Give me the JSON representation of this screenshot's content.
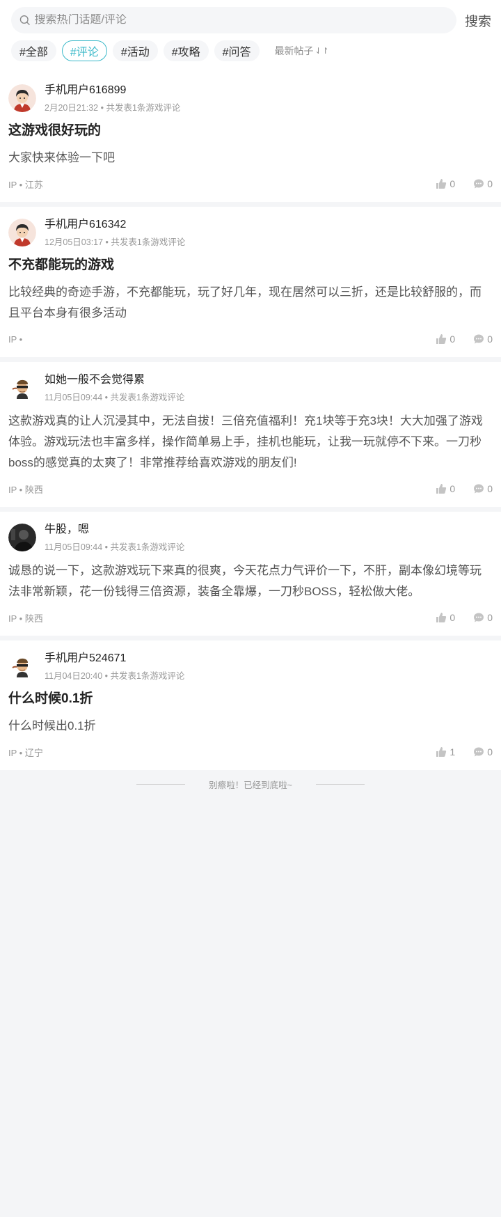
{
  "search": {
    "placeholder": "搜索热门话题/评论",
    "button": "搜索"
  },
  "tabs": [
    {
      "label": "#全部"
    },
    {
      "label": "#评论"
    },
    {
      "label": "#活动"
    },
    {
      "label": "#攻略"
    },
    {
      "label": "#问答"
    }
  ],
  "active_tab": "#评论",
  "sort_label": "最新帖子",
  "accent_color": "#3bb9c9",
  "posts": [
    {
      "user": "手机用户616899",
      "meta": "2月20日21:32 • 共发表1条游戏评论",
      "title": "这游戏很好玩的",
      "body": "大家快来体验一下吧",
      "ip": "IP • 江苏",
      "likes": "0",
      "comments": "0",
      "avatar": "cartoon-boy"
    },
    {
      "user": "手机用户616342",
      "meta": "12月05日03:17 • 共发表1条游戏评论",
      "title": "不充都能玩的游戏",
      "body": "比较经典的奇迹手游，不充都能玩，玩了好几年，现在居然可以三折，还是比较舒服的，而且平台本身有很多活动",
      "ip": "IP •",
      "likes": "0",
      "comments": "0",
      "avatar": "cartoon-boy"
    },
    {
      "user": "如她一般不会觉得累",
      "meta": "11月05日09:44 • 共发表1条游戏评论",
      "title": "",
      "body": "这款游戏真的让人沉浸其中，无法自拔！三倍充值福利！充1块等于充3块！大大加强了游戏体验。游戏玩法也丰富多样，操作简单易上手，挂机也能玩，让我一玩就停不下来。一刀秒boss的感觉真的太爽了！非常推荐给喜欢游戏的朋友们!",
      "ip": "IP • 陕西",
      "likes": "0",
      "comments": "0",
      "avatar": "cartoon-thief"
    },
    {
      "user": "牛股，嗯",
      "meta": "11月05日09:44 • 共发表1条游戏评论",
      "title": "",
      "body": "诚恳的说一下，这款游戏玩下来真的很爽，今天花点力气评价一下，不肝，副本像幻境等玩法非常新颖，花一份钱得三倍资源，装备全靠爆，一刀秒BOSS，轻松做大佬。",
      "ip": "IP • 陕西",
      "likes": "0",
      "comments": "0",
      "avatar": "photo-dark"
    },
    {
      "user": "手机用户524671",
      "meta": "11月04日20:40 • 共发表1条游戏评论",
      "title": "什么时候0.1折",
      "body": "什么时候出0.1折",
      "ip": "IP • 辽宁",
      "likes": "1",
      "comments": "0",
      "avatar": "cartoon-thief"
    }
  ],
  "end_text": "别瘵啦！已经到底啦~"
}
